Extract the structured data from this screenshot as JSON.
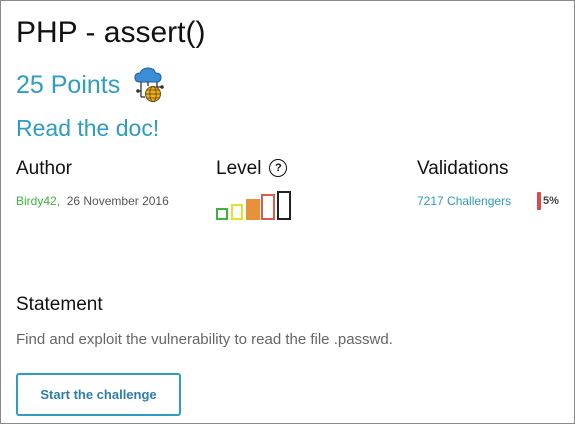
{
  "challenge": {
    "title": "PHP - assert()",
    "points": "25 Points",
    "subtitle": "Read the doc!",
    "points_icon": "cloud-network-icon"
  },
  "author": {
    "heading": "Author",
    "name": "Birdy42,",
    "date": "26 November 2016"
  },
  "level": {
    "heading": "Level",
    "help_glyph": "?",
    "current": 3,
    "max": 5,
    "colors": [
      "#3cb43c",
      "#e2e22a",
      "#e8913a",
      "#e05a4a",
      "#222222"
    ]
  },
  "validations": {
    "heading": "Validations",
    "challengers": "7217 Challengers",
    "percent_label": "5%",
    "percent_color": "#e04848"
  },
  "statement": {
    "heading": "Statement",
    "text": "Find and exploit the vulnerability to read the file .passwd."
  },
  "actions": {
    "start_label": "Start the challenge"
  },
  "colors": {
    "accent": "#2e9cc3",
    "author_link": "#3cb43c"
  }
}
